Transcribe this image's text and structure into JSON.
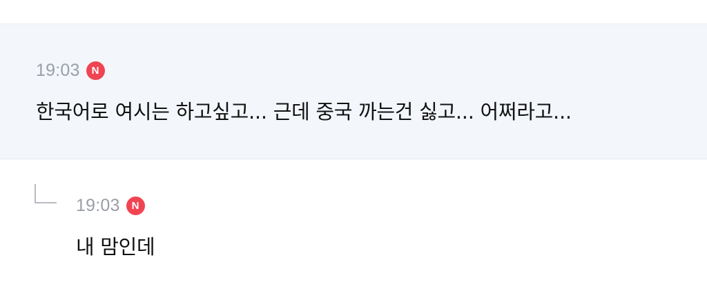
{
  "comments": [
    {
      "time": "19:03",
      "badge": "N",
      "text": "한국어로 여시는 하고싶고... 근데 중국 까는건 싫고... 어쩌라고..."
    }
  ],
  "replies": [
    {
      "time": "19:03",
      "badge": "N",
      "text": "내 맘인데"
    }
  ],
  "colors": {
    "badge_bg": "#f04452",
    "highlight_bg": "#f3f6fb",
    "time_text": "#9a9ea6"
  }
}
